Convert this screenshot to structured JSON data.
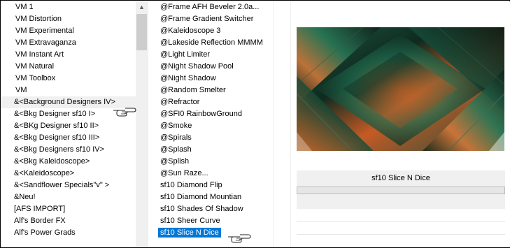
{
  "categories": [
    "VM 1",
    "VM Distortion",
    "VM Experimental",
    "VM Extravaganza",
    "VM Instant Art",
    "VM Natural",
    "VM Toolbox",
    "VM",
    "&<Background Designers IV>",
    "&<Bkg Designer sf10 I>",
    "&<BKg Designer sf10 II>",
    "&<Bkg Designer sf10 III>",
    "&<Bkg Designers sf10 IV>",
    "&<Bkg Kaleidoscope>",
    "&<Kaleidoscope>",
    "&<Sandflower Specials\"v\" >",
    "&Neu!",
    "[AFS IMPORT]",
    "Alf's Border FX",
    "Alf's Power Grads"
  ],
  "filters": [
    "@Frame AFH Beveler 2.0a...",
    "@Frame Gradient Switcher",
    "@Kaleidoscope 3",
    "@Lakeside Reflection MMMM",
    "@Light Limiter",
    "@Night Shadow Pool",
    "@Night Shadow",
    "@Random Smelter",
    "@Refractor",
    "@SFI0 RainbowGround",
    "@Smoke",
    "@Spirals",
    "@Splash",
    "@Splish",
    "@Sun Raze...",
    "sf10 Diamond Flip",
    "sf10 Diamond Mountian",
    "sf10 Shades Of Shadow",
    "sf10 Sheer Curve",
    "sf10 Slice N Dice"
  ],
  "selected_category_index": 8,
  "selected_filter_index": 19,
  "selected_filter_name": "sf10 Slice N Dice",
  "colors": {
    "selection": "#0078d7",
    "preview_orange": "#d2642a",
    "preview_green": "#1f6b4e",
    "preview_dark": "#0d1a14"
  },
  "icons": [
    "scroll-up-arrow-icon",
    "pointing-hand-icon"
  ]
}
